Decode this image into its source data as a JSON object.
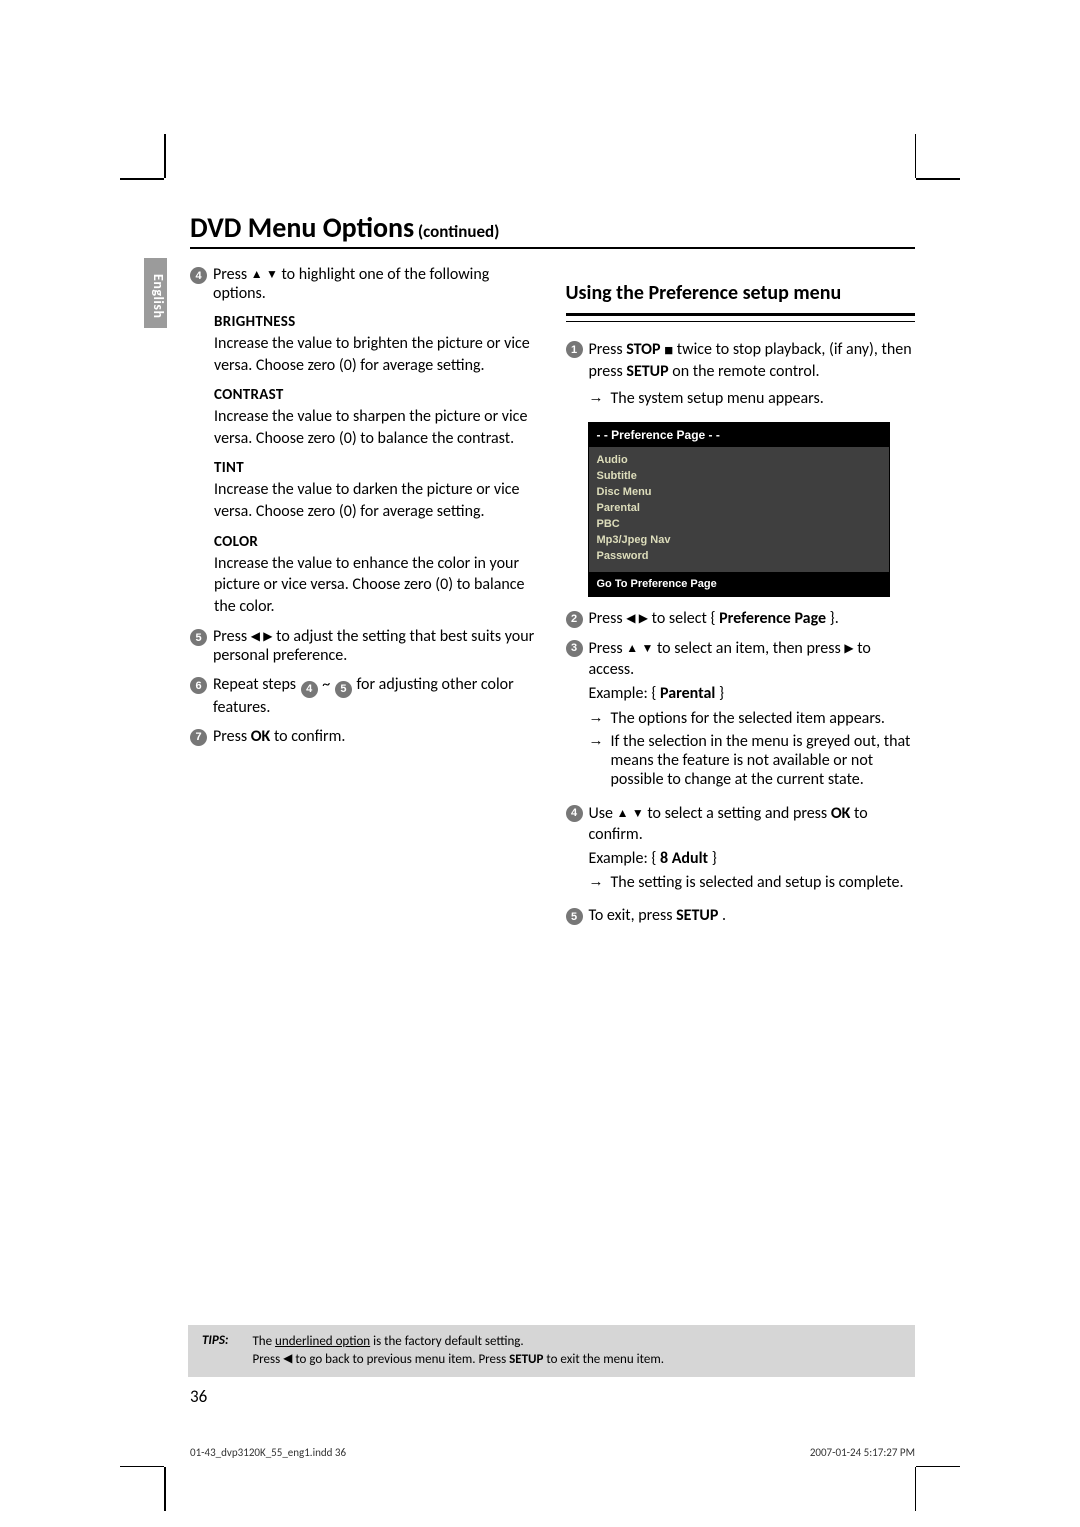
{
  "language_tab": "English",
  "title_main": "DVD Menu Options",
  "title_cont": "(continued)",
  "left": {
    "step4_line1": "Press ",
    "step4_icons": "▲ ▼",
    "step4_line2": " to highlight one of the following options.",
    "brightness_h": "BRIGHTNESS",
    "brightness_p": "Increase the value to brighten the picture or vice versa. Choose zero (0) for average setting.",
    "contrast_h": "CONTRAST",
    "contrast_p": "Increase the value to sharpen the picture or vice versa.  Choose zero (0) to balance the contrast.",
    "tint_h": "TINT",
    "tint_p": "Increase the value to darken the picture or vice versa.  Choose zero (0) for average setting.",
    "color_h": "COLOR",
    "color_p": "Increase the value to enhance the color in your picture or vice versa. Choose zero (0) to balance the color.",
    "step5a": "Press ",
    "step5_icons": "◀ ▶",
    "step5b": " to adjust the setting that best suits your personal preference.",
    "step6a": "Repeat steps ",
    "step6b": "~",
    "step6c": " for adjusting other color features.",
    "step7a": "Press ",
    "step7_ok": "OK",
    "step7b": " to confirm."
  },
  "right": {
    "heading": "Using the Preference setup menu",
    "s1_a": "Press ",
    "s1_stop": "STOP",
    "s1_b": "  twice to stop playback, (if any), then press ",
    "s1_setup": "SETUP",
    "s1_c": " on the remote control.",
    "s1_bullet": "The system setup menu appears.",
    "osd_title": "- -   Preference Page   - -",
    "osd_items": [
      "Audio",
      "Subtitle",
      "Disc Menu",
      "Parental",
      "PBC",
      "Mp3/Jpeg Nav",
      "Password"
    ],
    "osd_footer": "Go To Preference Page",
    "s2_a": "Press ",
    "s2_icons": "◀ ▶",
    "s2_b": " to select { ",
    "s2_bold": "Preference Page",
    "s2_c": " }.",
    "s3_a": "Press ",
    "s3_icons": "▲ ▼",
    "s3_b": " to select an item, then press ",
    "s3_icon2": "▶",
    "s3_c": " to access.",
    "s3_ex_a": "Example: { ",
    "s3_ex_b": "Parental",
    "s3_ex_c": " }",
    "s3_bul1": "The options for the selected item appears.",
    "s3_bul2": "If the selection in the menu is greyed out, that means the feature is not available or not possible to change at the current state.",
    "s4_a": "Use ",
    "s4_icons": "▲ ▼",
    "s4_b": " to select a setting and press ",
    "s4_ok": "OK",
    "s4_c": " to confirm.",
    "s4_ex_a": "Example: { ",
    "s4_ex_b": "8 Adult",
    "s4_ex_c": " }",
    "s4_bul": "The setting is selected and setup is complete.",
    "s5_a": "To exit, press ",
    "s5_b": "SETUP",
    "s5_c": "."
  },
  "tips_label": "TIPS:",
  "tips_line1a": "The ",
  "tips_line1b": "underlined option",
  "tips_line1c": " is the factory default setting.",
  "tips_line2a": "Press ",
  "tips_line2_icon": "◀",
  "tips_line2b": " to go back to previous menu item. Press ",
  "tips_line2_bold": "SETUP",
  "tips_line2c": " to exit the menu item.",
  "page_number": "36",
  "footer_left": "01-43_dvp3120K_55_eng1.indd   36",
  "footer_right": "2007-01-24   5:17:27 PM"
}
